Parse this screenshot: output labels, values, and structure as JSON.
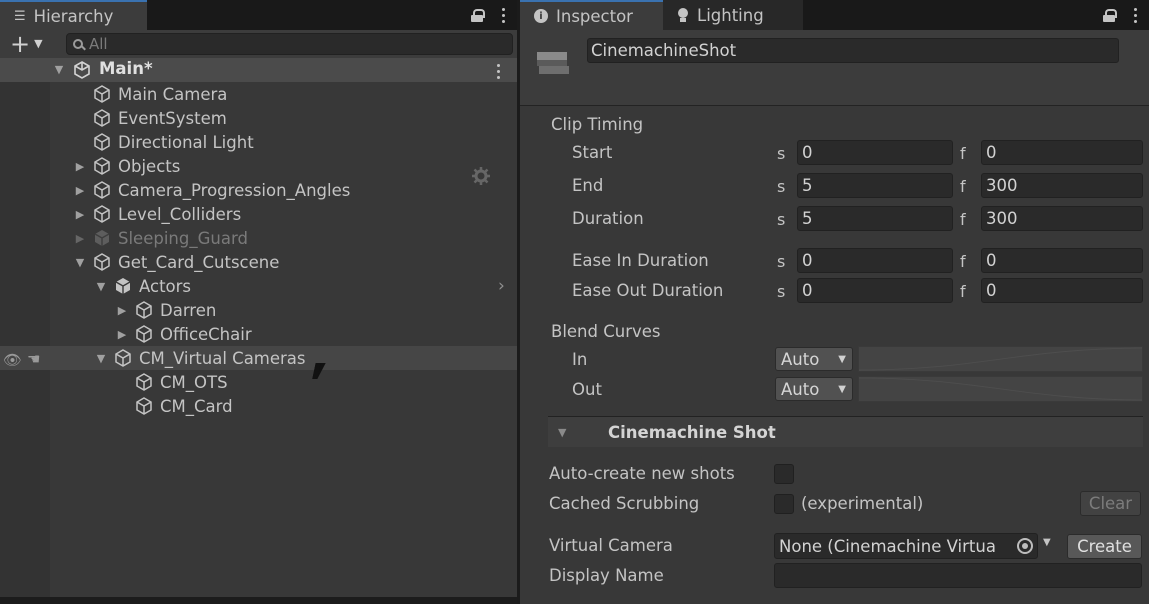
{
  "hierarchy": {
    "tab_label": "Hierarchy",
    "add_label": "+",
    "search_placeholder": "All",
    "scene_name": "Main*",
    "items": [
      {
        "label": "Main Camera"
      },
      {
        "label": "EventSystem"
      },
      {
        "label": "Directional Light"
      },
      {
        "label": "Objects"
      },
      {
        "label": "Camera_Progression_Angles"
      },
      {
        "label": "Level_Colliders"
      },
      {
        "label": "Sleeping_Guard"
      },
      {
        "label": "Get_Card_Cutscene"
      },
      {
        "label": "Actors"
      },
      {
        "label": "Darren"
      },
      {
        "label": "OfficeChair"
      },
      {
        "label": "CM_Virtual Cameras"
      },
      {
        "label": "CM_OTS"
      },
      {
        "label": "CM_Card"
      }
    ]
  },
  "inspector": {
    "tab_label": "Inspector",
    "lighting_tab_label": "Lighting",
    "object_name": "CinemachineShot",
    "clip_timing": {
      "title": "Clip Timing",
      "rows": [
        {
          "label": "Start",
          "s_unit": "s",
          "s": "0",
          "f_unit": "f",
          "f": "0"
        },
        {
          "label": "End",
          "s_unit": "s",
          "s": "5",
          "f_unit": "f",
          "f": "300"
        },
        {
          "label": "Duration",
          "s_unit": "s",
          "s": "5",
          "f_unit": "f",
          "f": "300"
        },
        {
          "label": "Ease In Duration",
          "s_unit": "s",
          "s": "0",
          "f_unit": "f",
          "f": "0"
        },
        {
          "label": "Ease Out Duration",
          "s_unit": "s",
          "s": "0",
          "f_unit": "f",
          "f": "0"
        }
      ]
    },
    "blend_curves": {
      "title": "Blend Curves",
      "in_label": "In",
      "in_value": "Auto",
      "out_label": "Out",
      "out_value": "Auto"
    },
    "cinemachine_shot": {
      "title": "Cinemachine Shot",
      "auto_create_label": "Auto-create new shots",
      "auto_create_checked": false,
      "cached_scrubbing_label": "Cached Scrubbing",
      "cached_scrubbing_checked": false,
      "experimental_label": "(experimental)",
      "clear_label": "Clear",
      "virtual_camera_label": "Virtual Camera",
      "virtual_camera_value": "None (Cinemachine Virtua",
      "create_label": "Create",
      "display_name_label": "Display Name",
      "display_name_value": ""
    }
  },
  "icons": [
    "hierarchy-list-icon",
    "lock-icon",
    "kebab-menu-icon",
    "search-icon",
    "unity-scene-icon",
    "gameobject-cube-icon",
    "prefab-cube-icon",
    "gear-icon",
    "visibility-eye-icon",
    "pickable-hand-icon",
    "info-icon",
    "lightbulb-icon",
    "object-picker-icon"
  ],
  "colors": {
    "accent_tab": "#3a72b0",
    "panel_bg": "#383838",
    "dark_bg": "#191919",
    "field_bg": "#2a2a2a"
  }
}
